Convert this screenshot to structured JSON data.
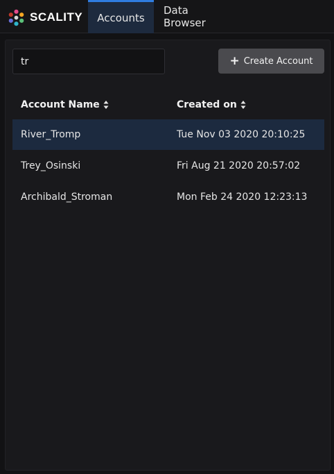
{
  "app": {
    "brand": "SCALITY",
    "tabs": [
      {
        "label": "Accounts",
        "active": true
      },
      {
        "label": "Data Browser",
        "active": false
      }
    ]
  },
  "accounts_page": {
    "search": {
      "value": "tr"
    },
    "create_button": {
      "label": "Create Account"
    },
    "table": {
      "columns": [
        {
          "label": "Account Name",
          "sortable": true
        },
        {
          "label": "Created on",
          "sortable": true
        }
      ],
      "rows": [
        {
          "name": "River_Tromp",
          "created_on": "Tue Nov 03 2020 20:10:25",
          "selected": true
        },
        {
          "name": "Trey_Osinski",
          "created_on": "Fri Aug 21 2020 20:57:02",
          "selected": false
        },
        {
          "name": "Archibald_Stroman",
          "created_on": "Mon Feb 24 2020 12:23:13",
          "selected": false
        }
      ]
    }
  },
  "colors": {
    "accent": "#2f7de1",
    "selected_row": "#1c2a3f",
    "button": "#4a4a4e"
  }
}
